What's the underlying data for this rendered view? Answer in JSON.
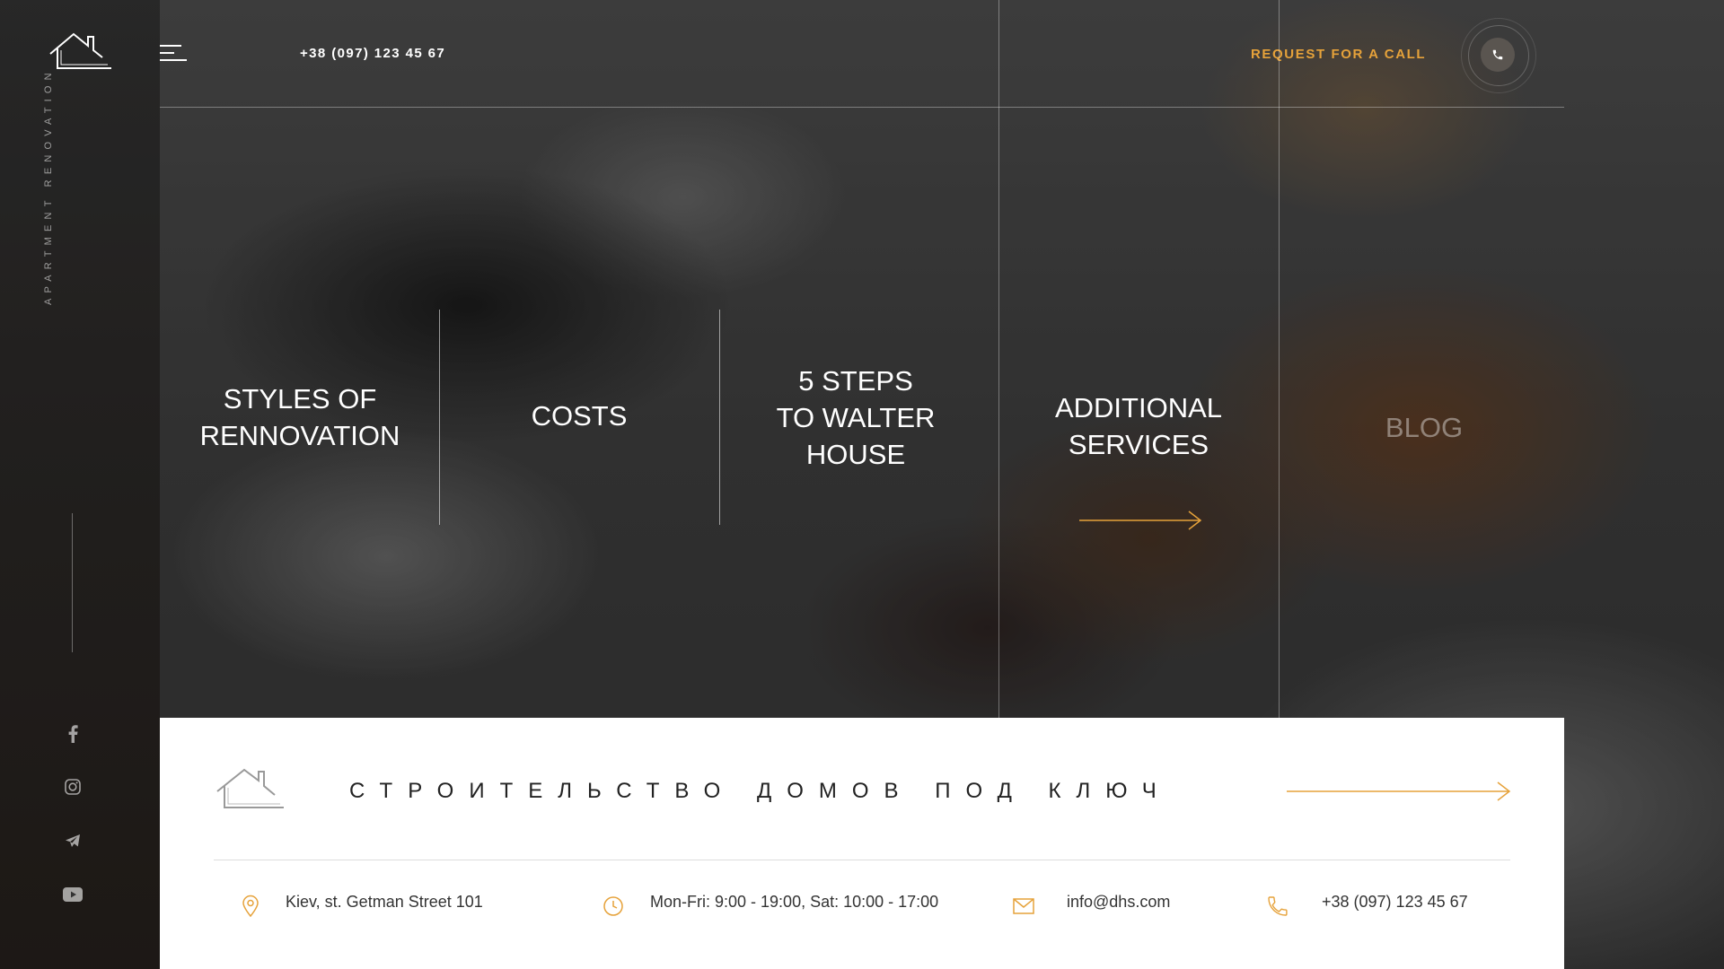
{
  "header": {
    "phone": "+38 (097) 123 45 67",
    "request_label": "REQUEST FOR A CALL"
  },
  "sidebar": {
    "vertical_text": "APARTMENT RENOVATION",
    "social": [
      "facebook-icon",
      "instagram-icon",
      "telegram-icon",
      "youtube-icon"
    ]
  },
  "menu": {
    "items": [
      {
        "label": "STYLES OF\nRENNOVATION"
      },
      {
        "label": "COSTS"
      },
      {
        "label": "5 STEPS\nTO WALTER\nHOUSE"
      },
      {
        "label": "ADDITIONAL\nSERVICES"
      },
      {
        "label": "BLOG"
      }
    ]
  },
  "card": {
    "title": "СТРОИТЕЛЬСТВО ДОМОВ ПОД КЛЮЧ",
    "address": "Kiev, st. Getman Street 101",
    "hours": "Mon-Fri: 9:00 - 19:00, Sat: 10:00 - 17:00",
    "email": "info@dhs.com",
    "phone": "+38 (097) 123 45 67"
  },
  "colors": {
    "accent": "#e6a23a",
    "card_bg": "#ffffff"
  }
}
